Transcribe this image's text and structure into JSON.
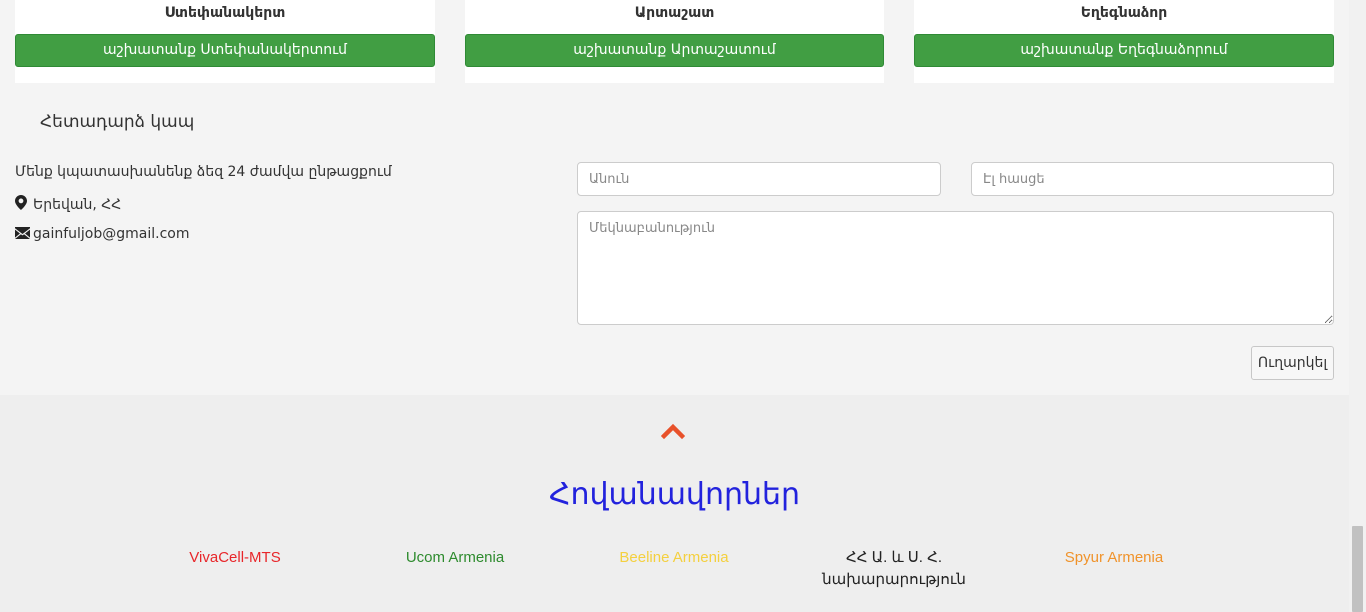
{
  "cities": [
    {
      "name": "Ստեփանակերտ",
      "button": "աշխատանք Ստեփանակերտում"
    },
    {
      "name": "Արտաշատ",
      "button": "աշխատանք Արտաշատում"
    },
    {
      "name": "Եղեգնաձոր",
      "button": "աշխատանք Եղեգնաձորում"
    }
  ],
  "contact": {
    "title": "Հետադարձ կապ",
    "response_note": "Մենք կպատասխանենք ձեզ 24 ժամվա ընթացքում",
    "location": "Երեվան, ՀՀ",
    "email": "gainfuljob@gmail.com",
    "location_icon": "map-marker-icon",
    "email_icon": "envelope-icon"
  },
  "form": {
    "name_placeholder": "Անուն",
    "email_placeholder": "Էլ հասցե",
    "message_placeholder": "Մեկնաբանություն",
    "send_label": "Ուղարկել"
  },
  "footer": {
    "scroll_top_icon": "chevron-up-icon",
    "sponsors_title": "Հովանավորներ",
    "sponsors": [
      {
        "name": "VivaCell-MTS",
        "color": "#e8262a"
      },
      {
        "name": "Ucom Armenia",
        "color": "#2e8b2e"
      },
      {
        "name": "Beeline Armenia",
        "color": "#f4d03f"
      },
      {
        "name": "ՀՀ Ա. և Ս. Հ. նախարարություն",
        "color": "#222222"
      },
      {
        "name": "Spyur Armenia",
        "color": "#f0932b"
      }
    ]
  },
  "colors": {
    "button_green": "#419e43",
    "accent_red": "#e8512a",
    "title_blue": "#2222dd"
  }
}
